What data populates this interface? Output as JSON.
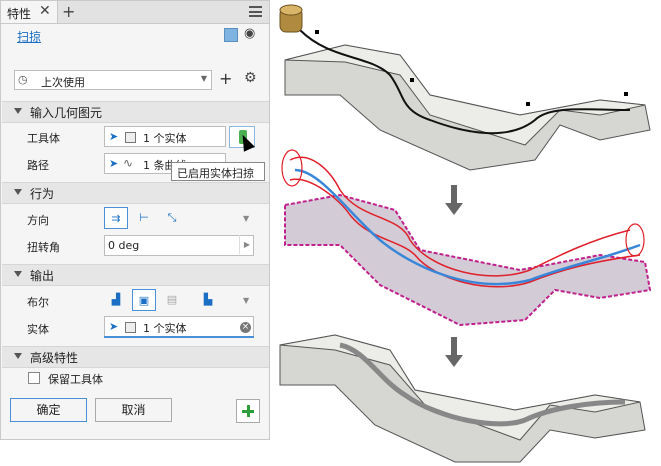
{
  "tabs": {
    "properties": "特性",
    "close_symbol": "✕",
    "add_symbol": "+"
  },
  "command": {
    "name": "扫掠"
  },
  "preset": {
    "value": "上次使用"
  },
  "sections": {
    "input_geometry": "输入几何图元",
    "behavior": "行为",
    "output": "输出",
    "advanced": "高级特性"
  },
  "fields": {
    "tool_body": {
      "label": "工具体",
      "value": "1 个实体"
    },
    "path": {
      "label": "路径",
      "value": "1 条曲线"
    },
    "direction": {
      "label": "方向"
    },
    "twist": {
      "label": "扭转角",
      "value": "0 deg"
    },
    "boolean": {
      "label": "布尔"
    },
    "solid": {
      "label": "实体",
      "value": "1 个实体"
    },
    "keep_tool": {
      "label": "保留工具体",
      "checked": false
    }
  },
  "tooltip": "已启用实体扫掠",
  "buttons": {
    "ok": "确定",
    "cancel": "取消"
  },
  "colors": {
    "accent": "#1a6fc4",
    "add_green": "#2e9e3a",
    "preview_red": "#e0202a",
    "selection_magenta": "#c0208c",
    "path_blue": "#3a86d8"
  }
}
